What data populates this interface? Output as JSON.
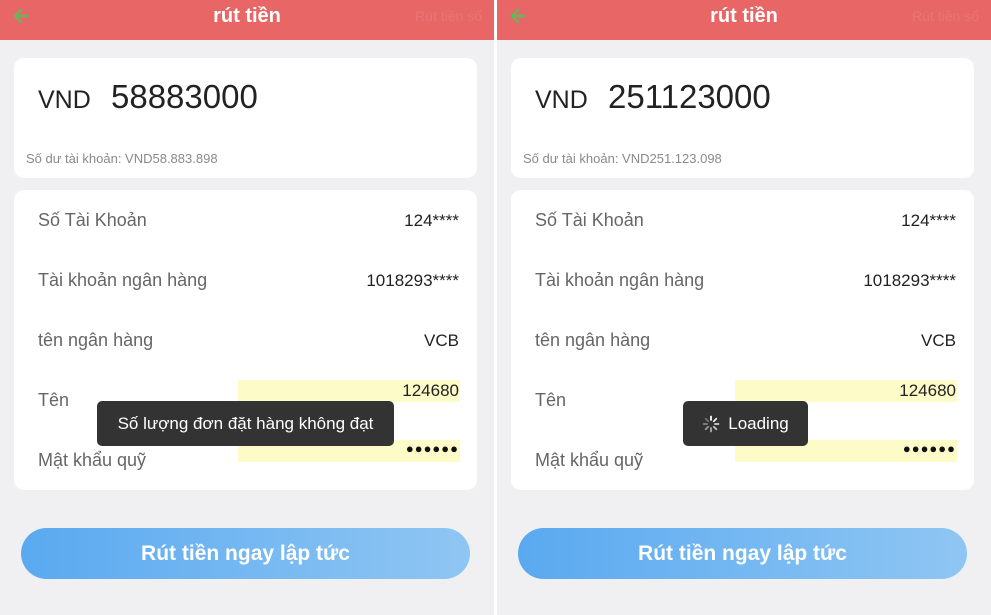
{
  "header": {
    "title": "rút tiền",
    "history": "Rút tiền sổ"
  },
  "screens": [
    {
      "amount": {
        "currency": "VND",
        "value": "58883000",
        "balance": "Số dư tài khoản:  VND58.883.898"
      },
      "rows": [
        {
          "label": "Số Tài Khoản",
          "value": "124****"
        },
        {
          "label": "Tài khoản ngân hàng",
          "value": "1018293****"
        },
        {
          "label": "tên ngân hàng",
          "value": "VCB"
        },
        {
          "label": "Tên",
          "value": "124680"
        },
        {
          "label": "Mật khẩu quỹ",
          "value": "●●●●●●"
        }
      ],
      "submit_label": "Rút tiền ngay lập tức",
      "toast": "Số lượng đơn đặt hàng không đạt"
    },
    {
      "amount": {
        "currency": "VND",
        "value": "251123000",
        "balance": "Số dư tài khoản:  VND251.123.098"
      },
      "rows": [
        {
          "label": "Số Tài Khoản",
          "value": "124****"
        },
        {
          "label": "Tài khoản ngân hàng",
          "value": "1018293****"
        },
        {
          "label": "tên ngân hàng",
          "value": "VCB"
        },
        {
          "label": "Tên",
          "value": "124680"
        },
        {
          "label": "Mật khẩu quỹ",
          "value": "●●●●●●"
        }
      ],
      "submit_label": "Rút tiền ngay lập tức",
      "toast": "Loading"
    }
  ],
  "colors": {
    "header": "#e86666",
    "button_start": "#5aa9f0",
    "button_end": "#8fc6f3",
    "highlight": "#fdfbc8"
  },
  "icons": {
    "back": "arrow-left-icon",
    "spinner": "spinner-icon"
  }
}
